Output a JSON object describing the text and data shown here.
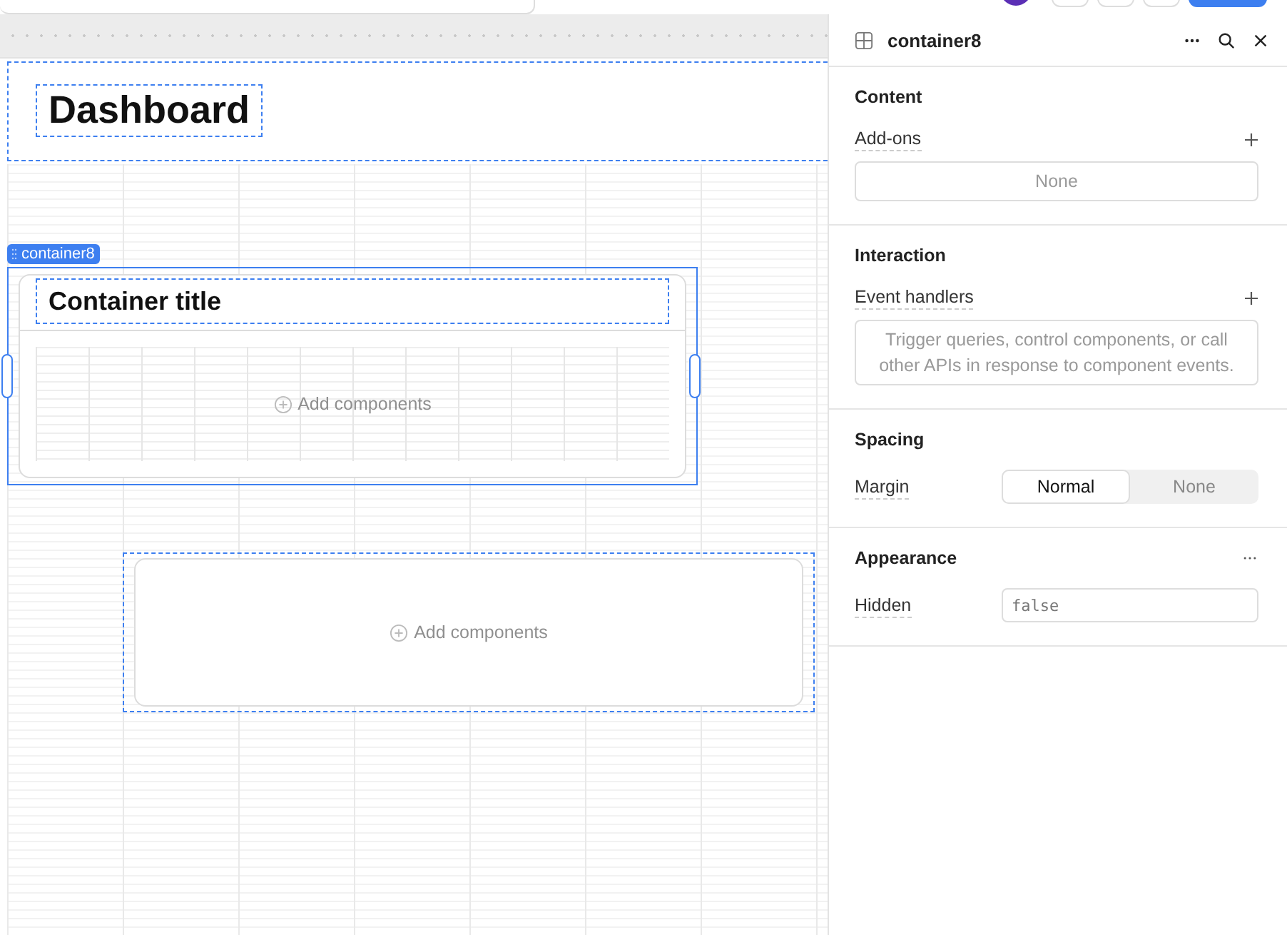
{
  "canvas": {
    "header": {
      "title": "Dashboard"
    },
    "selected_container": {
      "label": "container8",
      "title": "Container title",
      "placeholder": "Add components"
    },
    "empty_container": {
      "placeholder": "Add components"
    }
  },
  "inspector": {
    "title": "container8",
    "sections": [
      {
        "title": "Content",
        "menu": false,
        "rows": [
          {
            "kind": "list",
            "label": "Add-ons",
            "addable": true,
            "empty_text": "None"
          }
        ]
      },
      {
        "title": "Interaction",
        "menu": false,
        "rows": [
          {
            "kind": "list",
            "label": "Event handlers",
            "addable": true,
            "empty_text": "Trigger queries, control components, or call other APIs in response to component events."
          }
        ]
      },
      {
        "title": "Spacing",
        "menu": false,
        "rows": [
          {
            "kind": "segmented",
            "label": "Margin",
            "options": [
              {
                "label": "Normal",
                "selected": true
              },
              {
                "label": "None",
                "selected": false
              }
            ]
          }
        ]
      },
      {
        "title": "Appearance",
        "menu": true,
        "rows": [
          {
            "kind": "code",
            "label": "Hidden",
            "value": "false"
          }
        ]
      }
    ]
  }
}
